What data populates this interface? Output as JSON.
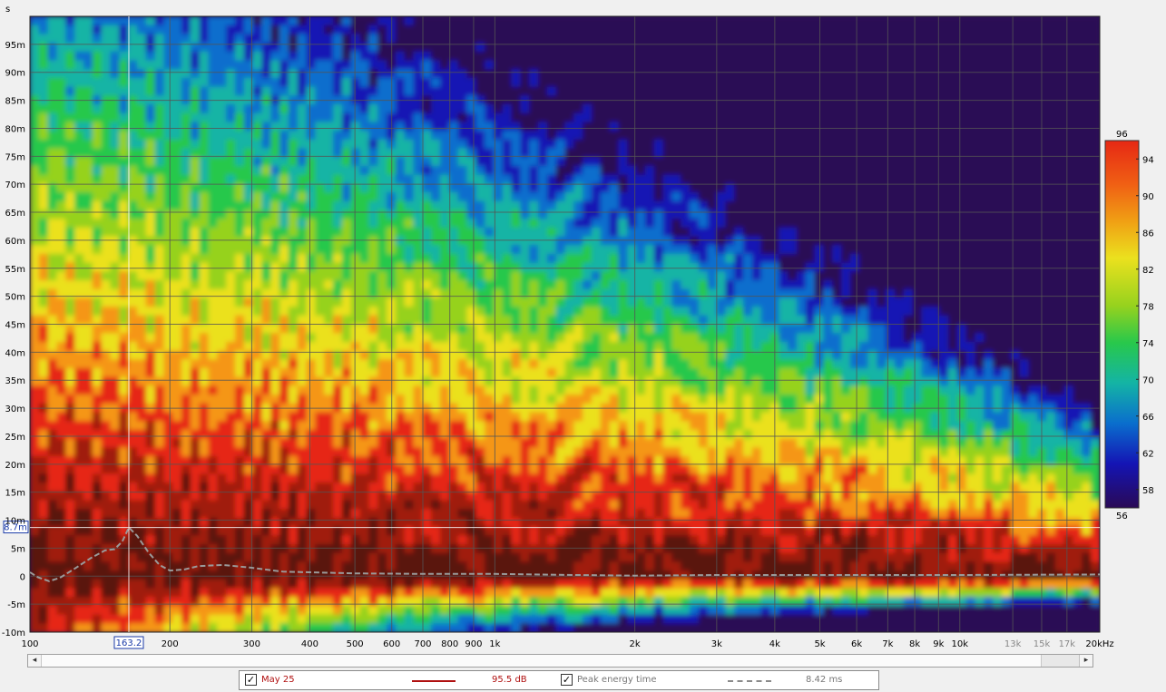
{
  "chart_data": {
    "type": "heatmap",
    "title": "",
    "ylabel": "s",
    "x_scale": "log",
    "xlim": [
      100,
      20000
    ],
    "ylim": [
      -0.01,
      0.1
    ],
    "x_ticks": [
      {
        "v": 100,
        "label": "100"
      },
      {
        "v": 200,
        "label": "200"
      },
      {
        "v": 300,
        "label": "300"
      },
      {
        "v": 400,
        "label": "400"
      },
      {
        "v": 500,
        "label": "500"
      },
      {
        "v": 600,
        "label": "600"
      },
      {
        "v": 700,
        "label": "700"
      },
      {
        "v": 800,
        "label": "800"
      },
      {
        "v": 900,
        "label": "900"
      },
      {
        "v": 1000,
        "label": "1k"
      },
      {
        "v": 2000,
        "label": "2k"
      },
      {
        "v": 3000,
        "label": "3k"
      },
      {
        "v": 4000,
        "label": "4k"
      },
      {
        "v": 5000,
        "label": "5k"
      },
      {
        "v": 6000,
        "label": "6k"
      },
      {
        "v": 7000,
        "label": "7k"
      },
      {
        "v": 8000,
        "label": "8k"
      },
      {
        "v": 9000,
        "label": "9k"
      },
      {
        "v": 10000,
        "label": "10k"
      },
      {
        "v": 13000,
        "label": "13k"
      },
      {
        "v": 15000,
        "label": "15k"
      },
      {
        "v": 17000,
        "label": "17k"
      },
      {
        "v": 20000,
        "label": "20kHz"
      }
    ],
    "y_ticks": [
      {
        "v": -0.01,
        "label": "-10m"
      },
      {
        "v": -0.005,
        "label": "-5m"
      },
      {
        "v": 0,
        "label": "0"
      },
      {
        "v": 0.005,
        "label": "5m"
      },
      {
        "v": 0.01,
        "label": "10m"
      },
      {
        "v": 0.015,
        "label": "15m"
      },
      {
        "v": 0.02,
        "label": "20m"
      },
      {
        "v": 0.025,
        "label": "25m"
      },
      {
        "v": 0.03,
        "label": "30m"
      },
      {
        "v": 0.035,
        "label": "35m"
      },
      {
        "v": 0.04,
        "label": "40m"
      },
      {
        "v": 0.045,
        "label": "45m"
      },
      {
        "v": 0.05,
        "label": "50m"
      },
      {
        "v": 0.055,
        "label": "55m"
      },
      {
        "v": 0.06,
        "label": "60m"
      },
      {
        "v": 0.065,
        "label": "65m"
      },
      {
        "v": 0.07,
        "label": "70m"
      },
      {
        "v": 0.075,
        "label": "75m"
      },
      {
        "v": 0.08,
        "label": "80m"
      },
      {
        "v": 0.085,
        "label": "85m"
      },
      {
        "v": 0.09,
        "label": "90m"
      },
      {
        "v": 0.095,
        "label": "95m"
      }
    ],
    "colorbar": {
      "min": 56,
      "max": 96,
      "ticks": [
        94,
        90,
        86,
        82,
        78,
        74,
        70,
        66,
        62,
        58
      ],
      "top_label": "96",
      "bottom_label": "56"
    },
    "cursor": {
      "x": 163.2,
      "x_label": "163.2",
      "y": 0.0087,
      "y_label": "8.7m"
    },
    "grid": true,
    "series": [
      {
        "name": "Peak energy time",
        "style": "dashed",
        "color": "#9a9a9a",
        "points": [
          [
            100,
            0.0007
          ],
          [
            104,
            -0.0002
          ],
          [
            110,
            -0.0009
          ],
          [
            116,
            -0.0003
          ],
          [
            124,
            0.0012
          ],
          [
            135,
            0.0032
          ],
          [
            145,
            0.0046
          ],
          [
            152,
            0.0048
          ],
          [
            158,
            0.0062
          ],
          [
            163.2,
            0.0087
          ],
          [
            170,
            0.0072
          ],
          [
            180,
            0.0042
          ],
          [
            190,
            0.002
          ],
          [
            200,
            0.001
          ],
          [
            215,
            0.0012
          ],
          [
            230,
            0.0018
          ],
          [
            260,
            0.002
          ],
          [
            300,
            0.0015
          ],
          [
            350,
            0.0008
          ],
          [
            400,
            0.0007
          ],
          [
            500,
            0.0005
          ],
          [
            700,
            0.0004
          ],
          [
            1000,
            0.0004
          ],
          [
            1500,
            0.0002
          ],
          [
            2000,
            0.0001
          ],
          [
            3000,
            0.0002
          ],
          [
            5000,
            0.0002
          ],
          [
            10000,
            0.0002
          ],
          [
            20000,
            0.0003
          ]
        ]
      }
    ]
  },
  "scrollbar": {
    "left_arrow": "◂",
    "right_arrow": "▸"
  },
  "legend": {
    "items": [
      {
        "name": "May 25",
        "checked": true,
        "value": "95.5 dB",
        "color": "#b01010"
      },
      {
        "name": "Peak energy time",
        "checked": true,
        "value": "8.42 ms",
        "color": "#9a9a9a"
      }
    ]
  },
  "colors": {
    "background": "#f0f0f0",
    "grid": "#555555",
    "palette": [
      "#2a0a55",
      "#1414b4",
      "#0a6ecd",
      "#14b4a5",
      "#28c84b",
      "#96d21e",
      "#ebe11e",
      "#f59614",
      "#e62814",
      "#a01a10",
      "#5a1208"
    ]
  }
}
